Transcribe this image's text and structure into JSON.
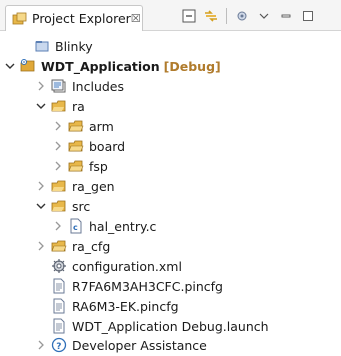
{
  "panel": {
    "tab_label": "Project Explorer",
    "close_glyph": "☒"
  },
  "toolbar": {
    "icons": [
      "collapse-all-icon",
      "link-with-editor-icon",
      "filter-icon",
      "view-menu-icon",
      "minimize-icon",
      "maximize-icon"
    ]
  },
  "tree": {
    "blinky": "Blinky",
    "project": "WDT_Application",
    "project_config": "[Debug]",
    "includes": "Includes",
    "ra": "ra",
    "arm": "arm",
    "board": "board",
    "fsp": "fsp",
    "ra_gen": "ra_gen",
    "src": "src",
    "hal_entry": "hal_entry.c",
    "ra_cfg": "ra_cfg",
    "configuration": "configuration.xml",
    "pincfg1": "R7FA6M3AH3CFC.pincfg",
    "pincfg2": "RA6M3-EK.pincfg",
    "launch": "WDT_Application Debug.launch",
    "dev_assist": "Developer Assistance"
  },
  "colors": {
    "folder": "#e8b84a",
    "project_folder": "#e0a838",
    "accent_blue": "#2f6fb8",
    "debug_label": "#b07b2c"
  }
}
